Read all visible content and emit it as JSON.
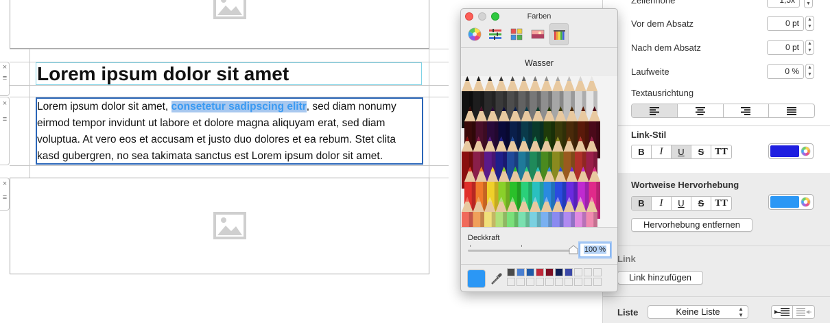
{
  "document": {
    "heading": "Lorem ipsum dolor sit amet",
    "paragraph_before": "Lorem ipsum dolor sit amet, ",
    "paragraph_highlight": "consetetur sadipscing elitr",
    "paragraph_after": ", sed diam nonumy eirmod tempor invidunt ut labore et dolore magna aliquyam erat, sed diam voluptua. At vero eos et accusam et justo duo dolores et ea rebum. Stet clita kasd gubergren, no sea takimata sanctus est Lorem ipsum dolor sit amet.",
    "handle_close": "×",
    "handle_drag": "≡"
  },
  "colors_panel": {
    "title": "Farben",
    "selected_pencil": "Wasser",
    "opacity_label": "Deckkraft",
    "opacity_value": "100 %",
    "opacity_fraction": 1.0,
    "current_color": "#2b97f5",
    "swatches": [
      "#4a4a4a",
      "#4a7fd0",
      "#1f5aa8",
      "#c0283a",
      "#7e0e22",
      "#0e1f55",
      "#3b48a8"
    ]
  },
  "inspector": {
    "line_height_label": "Zeilenhöhe",
    "line_height_value": "1,5x",
    "space_before_label": "Vor dem Absatz",
    "space_before_value": "0 pt",
    "space_after_label": "Nach dem Absatz",
    "space_after_value": "0 pt",
    "tracking_label": "Laufweite",
    "tracking_value": "0 %",
    "alignment_label": "Textausrichtung",
    "link_style_label": "Link-Stil",
    "link_style_color": "#1f1fe0",
    "highlight_label": "Wortweise Hervorhebung",
    "highlight_color": "#2b97f5",
    "remove_highlight_button": "Hervorhebung entfernen",
    "link_label": "Link",
    "add_link_button": "Link hinzufügen",
    "list_label": "Liste",
    "list_value": "Keine Liste",
    "format_buttons": [
      "B",
      "I",
      "U",
      "S",
      "TT"
    ]
  }
}
